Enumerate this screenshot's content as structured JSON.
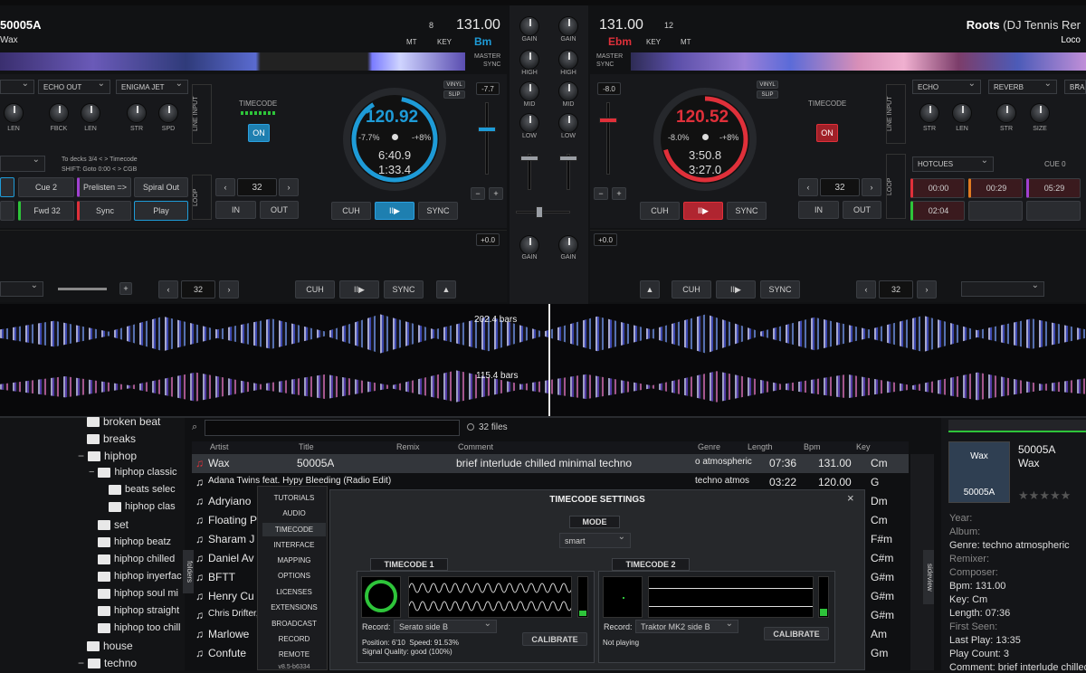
{
  "deck_left": {
    "track_id": "50005A",
    "artist": "Wax",
    "bpm": "131.00",
    "key": "Bm",
    "pitch_counter": "8",
    "mt": "MT",
    "key_label": "KEY",
    "master": "MASTER",
    "sync": "SYNC",
    "vinyl": "VINYL",
    "slip": "SLIP",
    "pitch_val": "-7.7",
    "effects": [
      "ECHO OUT",
      "ENIGMA JET"
    ],
    "knob_labels": [
      "LEN",
      "FBCK",
      "LEN",
      "STR",
      "SPD"
    ],
    "timecode": "TIMECODE",
    "on": "ON",
    "line_input": "LINE INPUT",
    "jog_bpm": "120.92",
    "jog_pitch": "-7.7%",
    "jog_range": "-+8%",
    "jog_elapsed": "6:40.9",
    "jog_remain": "1:33.4",
    "hint1": "To decks 3/4 < > Timecode",
    "hint2": "SHIFT: Goto 0:00 < > CGB",
    "pads": [
      "Cue 2",
      "Prelisten =>",
      "Spiral Out",
      "Fwd 32",
      "Sync",
      "Play"
    ],
    "loop": "LOOP",
    "loop_size": "32",
    "in": "IN",
    "out": "OUT",
    "cuh": "CUH",
    "play": "II▶",
    "sync_btn": "SYNC",
    "lower_pitch": "+0.0",
    "lower_loop": "32",
    "lower_cuh": "CUH",
    "lower_sync": "SYNC"
  },
  "deck_right": {
    "bpm": "131.00",
    "key": "Ebm",
    "pitch_counter": "12",
    "mt": "MT",
    "key_label": "KEY",
    "master": "MASTER",
    "sync": "SYNC",
    "title": "Roots",
    "title_suffix": "(DJ Tennis Rer",
    "artist": "Loco",
    "vinyl": "VINYL",
    "slip": "SLIP",
    "pitch_val": "-8.0",
    "effects": [
      "ECHO",
      "REVERB",
      "BRA"
    ],
    "knob_labels": [
      "STR",
      "LEN",
      "STR",
      "SIZE"
    ],
    "timecode": "TIMECODE",
    "on": "ON",
    "line_input": "LINE INPUT",
    "jog_bpm": "120.52",
    "jog_pitch": "-8.0%",
    "jog_range": "-+8%",
    "jog_elapsed": "3:50.8",
    "jog_remain": "3:27.0",
    "hotcues": "HOTCUES",
    "cue_label": "CUE 0",
    "cues": [
      "00:00",
      "00:29",
      "05:29",
      "02:04"
    ],
    "loop": "LOOP",
    "loop_size": "32",
    "in": "IN",
    "out": "OUT",
    "cuh": "CUH",
    "play": "II▶",
    "sync_btn": "SYNC",
    "lower_pitch": "+0.0",
    "lower_loop": "32",
    "lower_cuh": "CUH",
    "lower_sync": "SYNC"
  },
  "mixer": {
    "labels": [
      "GAIN",
      "GAIN",
      "HIGH",
      "HIGH",
      "MID",
      "MID",
      "LOW",
      "LOW"
    ],
    "lower_gain": [
      "GAIN",
      "GAIN"
    ]
  },
  "waveform": {
    "bars_top": "202.4 bars",
    "bars_bottom": "115.4 bars"
  },
  "browser": {
    "file_count": "32 files",
    "folders_tab": "folders",
    "sideview_tab": "sideview",
    "columns": [
      "Artist",
      "Title",
      "Remix",
      "Comment",
      "Genre",
      "Length",
      "Bpm",
      "Key"
    ],
    "rows": [
      {
        "artist": "Wax",
        "title": "50005A",
        "comment": "brief interlude chilled minimal techno",
        "genre": "o atmospheric",
        "length": "07:36",
        "bpm": "131.00",
        "key": "Cm"
      },
      {
        "artist": "Adana Twins feat. Hypy Bleeding (Radio Edit)",
        "title": "",
        "comment": "",
        "genre": "techno atmos",
        "length": "03:22",
        "bpm": "120.00",
        "key": "G"
      },
      {
        "artist": "Adryiano",
        "title": "",
        "comment": "",
        "genre": "",
        "length": "",
        "bpm": "",
        "key": "Dm"
      },
      {
        "artist": "Floating P",
        "title": "",
        "comment": "",
        "genre": "",
        "length": "",
        "bpm": "",
        "key": "Cm"
      },
      {
        "artist": "Sharam J",
        "title": "",
        "comment": "",
        "genre": "",
        "length": "",
        "bpm": "",
        "key": "F#m"
      },
      {
        "artist": "Daniel Av",
        "title": "",
        "comment": "",
        "genre": "",
        "length": "",
        "bpm": "",
        "key": "C#m"
      },
      {
        "artist": "BFTT",
        "title": "",
        "comment": "",
        "genre": "",
        "length": "",
        "bpm": "",
        "key": "G#m"
      },
      {
        "artist": "Henry Cu",
        "title": "",
        "comment": "",
        "genre": "",
        "length": "",
        "bpm": "",
        "key": "G#m"
      },
      {
        "artist": "Chris Drifter,",
        "title": "",
        "comment": "",
        "genre": "",
        "length": "",
        "bpm": "",
        "key": "G#m"
      },
      {
        "artist": "Marlowe",
        "title": "",
        "comment": "",
        "genre": "",
        "length": "",
        "bpm": "",
        "key": "Am"
      },
      {
        "artist": "Confute",
        "title": "",
        "comment": "",
        "genre": "",
        "length": "",
        "bpm": "",
        "key": "Gm"
      }
    ]
  },
  "folders": {
    "items": [
      "broken beat",
      "breaks",
      "hiphop",
      "hiphop classic",
      "beats selec",
      "hiphop clas",
      "set",
      "hiphop beatz",
      "hiphop chilled",
      "hiphop inyerfac",
      "hiphop soul mi",
      "hiphop straight",
      "hiphop too chill",
      "house",
      "techno"
    ]
  },
  "sideview": {
    "cover_title": "Wax",
    "cover_sub": "50005A",
    "track_title": "50005A",
    "track_artist": "Wax",
    "info": [
      "Year:",
      "Album:",
      "Genre: techno atmospheric",
      "Remixer:",
      "Composer:",
      "Bpm: 131.00",
      "Key: Cm",
      "Length: 07:36",
      "First Seen:",
      "Last Play: 13:35",
      "Play Count: 3",
      "Comment: brief interlude chilled"
    ]
  },
  "settings": {
    "menu": [
      "TUTORIALS",
      "AUDIO",
      "TIMECODE",
      "INTERFACE",
      "MAPPING",
      "OPTIONS",
      "LICENSES",
      "EXTENSIONS",
      "BROADCAST",
      "RECORD",
      "REMOTE",
      "v8.5-b6334"
    ],
    "title": "TIMECODE SETTINGS",
    "close": "×",
    "mode_label": "MODE",
    "mode_value": "smart",
    "tc1": {
      "title": "TIMECODE 1",
      "record_label": "Record:",
      "record_value": "Serato side B",
      "calibrate": "CALIBRATE",
      "status1": "Position: 6'10  Speed: 91.53%",
      "status2": "Signal Quality: good (100%)"
    },
    "tc2": {
      "title": "TIMECODE 2",
      "record_label": "Record:",
      "record_value": "Traktor MK2 side B",
      "calibrate": "CALIBRATE",
      "status1": "Not playing"
    }
  },
  "colors": {
    "left_accent": "#1e9bd7",
    "right_accent": "#e0303a",
    "green": "#2ec43a"
  }
}
